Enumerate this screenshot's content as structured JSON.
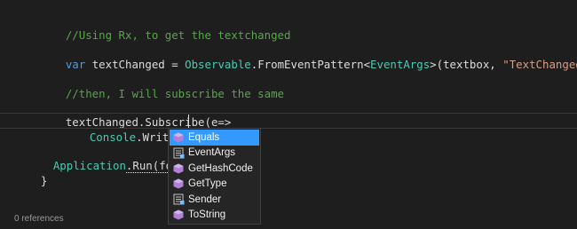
{
  "editor": {
    "lines": {
      "comment1": "//Using Rx, to get the textchanged",
      "l2_kw": "var",
      "l2_var": " textChanged = ",
      "l2_type": "Observable",
      "l2_method": ".FromEventPattern<",
      "l2_generic": "EventArgs",
      "l2_args": ">(textbox, ",
      "l2_string": "\"TextChanged\"",
      "l2_end": ");",
      "comment2": "//then, I will subscribe the same",
      "l4": "textChanged.Subscribe(e=>",
      "l5_type": "Console",
      "l5_rest": ".WriteLine(e.",
      "l6_type": "Application",
      "l6_call": ".Run(form)",
      "l6_end": ";",
      "l7": "}"
    },
    "codelens": "0 references"
  },
  "completion": {
    "items": [
      {
        "label": "Equals",
        "icon": "method-icon",
        "selected": true
      },
      {
        "label": "EventArgs",
        "icon": "property-icon",
        "selected": false
      },
      {
        "label": "GetHashCode",
        "icon": "method-icon",
        "selected": false
      },
      {
        "label": "GetType",
        "icon": "method-icon",
        "selected": false
      },
      {
        "label": "Sender",
        "icon": "property-icon",
        "selected": false
      },
      {
        "label": "ToString",
        "icon": "method-icon",
        "selected": false
      }
    ]
  },
  "colors": {
    "background": "#1e1e1e",
    "comment": "#57a64a",
    "keyword": "#569cd6",
    "type": "#4ec9b0",
    "string": "#d69d85",
    "selection": "#3399ff",
    "method_icon": "#b180d7"
  }
}
